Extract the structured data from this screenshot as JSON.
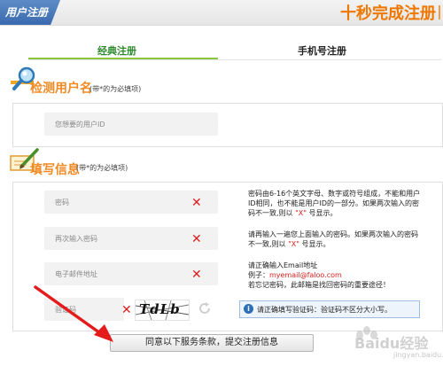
{
  "header": {
    "title": "用户注册",
    "slogan": "十秒完成注册"
  },
  "tabs": [
    {
      "label": "经典注册",
      "active": true
    },
    {
      "label": "手机号注册",
      "active": false
    }
  ],
  "section_username": {
    "title": "检测用户名",
    "note": "(带*的为必填项)",
    "field_placeholder": "您想要的用户ID"
  },
  "section_info": {
    "title": "填写信息",
    "note": "(带*的为必填项)",
    "fields": [
      {
        "placeholder": "密码"
      },
      {
        "placeholder": "再次输入密码"
      },
      {
        "placeholder": "电子邮件地址"
      },
      {
        "placeholder": "验证码"
      }
    ],
    "hints": {
      "password_1": "密码由6-16个英文字母、数字或符号组成，不能和用户",
      "password_2": "ID相同，也不能是用户ID的一部分。如果两次输入的密",
      "password_3a": "码不一致,则以 ",
      "password_3b": "\"X\"",
      "password_3c": " 号显示。",
      "confirm_1": "请再输入一遍您上面输入的密码。如果两次输入的密码",
      "confirm_2a": "不一致,则以 ",
      "confirm_2b": "\"X\"",
      "confirm_2c": " 号显示。",
      "email_1": "请正确输入Email地址",
      "email_2a": "例子：",
      "email_2b": "myemail@faloo.com",
      "email_3": "若忘记密码，此邮箱是找回密码的重要途径！"
    },
    "captcha_text": "TdLb",
    "captcha_info": "请正确填写验证码：验证码不区分大小写。"
  },
  "submit_label": "同意以下服务条款，提交注册信息",
  "watermark": {
    "text": "Baidu经验",
    "sub": "jingyan.baidu.com"
  },
  "colors": {
    "header_blue": "#3a6aae",
    "slogan_orange": "#ee7700",
    "tab_green": "#2e8b2e",
    "error_red": "#dd1f1f"
  }
}
